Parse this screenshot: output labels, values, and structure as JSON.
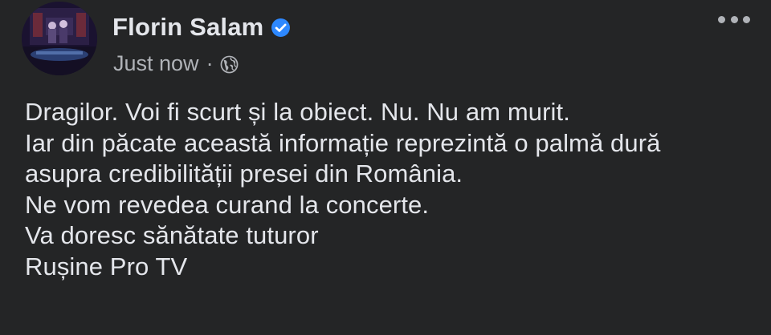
{
  "post": {
    "author": "Florin Salam",
    "verified_icon": "verified-badge-icon",
    "timestamp": "Just now",
    "separator": "·",
    "audience_icon": "globe-icon",
    "menu_icon": "more-options-icon",
    "lines": [
      "Dragilor. Voi fi scurt și la obiect. Nu. Nu am murit.",
      "Iar din păcate această informație reprezintă o palmă dură",
      "asupra credibilității presei din România.",
      "Ne vom revedea curand la concerte.",
      "Va doresc sănătate tuturor",
      "Rușine Pro TV"
    ]
  },
  "colors": {
    "background": "#242526",
    "primary_text": "#e4e6eb",
    "secondary_text": "#b0b3b8",
    "verified_blue": "#2d88ff"
  }
}
